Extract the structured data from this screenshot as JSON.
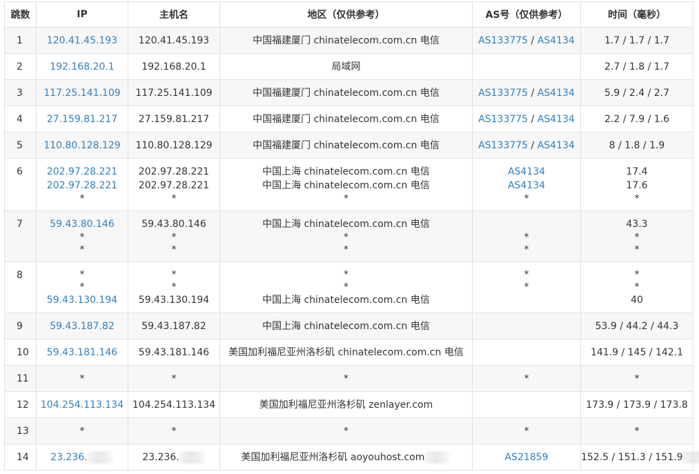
{
  "headers": {
    "hop": "跳数",
    "ip": "IP",
    "host": "主机名",
    "region": "地区（仅供参考）",
    "as": "AS号（仅供参考）",
    "time": "时间（毫秒）"
  },
  "rows": [
    {
      "hop": "1",
      "ip": [
        "120.41.45.193"
      ],
      "host": [
        "120.41.45.193"
      ],
      "region": [
        "中国福建厦门 chinatelecom.com.cn 电信"
      ],
      "as": [
        [
          "AS133775",
          "AS4134"
        ]
      ],
      "time": [
        "1.7 / 1.7 / 1.7"
      ]
    },
    {
      "hop": "2",
      "ip": [
        "192.168.20.1"
      ],
      "host": [
        "192.168.20.1"
      ],
      "region": [
        "局域网"
      ],
      "as": [
        []
      ],
      "time": [
        "2.7 / 1.8 / 1.7"
      ]
    },
    {
      "hop": "3",
      "ip": [
        "117.25.141.109"
      ],
      "host": [
        "117.25.141.109"
      ],
      "region": [
        "中国福建厦门 chinatelecom.com.cn 电信"
      ],
      "as": [
        [
          "AS133775",
          "AS4134"
        ]
      ],
      "time": [
        "5.9 / 2.4 / 2.7"
      ]
    },
    {
      "hop": "4",
      "ip": [
        "27.159.81.217"
      ],
      "host": [
        "27.159.81.217"
      ],
      "region": [
        "中国福建厦门 chinatelecom.com.cn 电信"
      ],
      "as": [
        [
          "AS133775",
          "AS4134"
        ]
      ],
      "time": [
        "2.2 / 7.9 / 1.6"
      ]
    },
    {
      "hop": "5",
      "ip": [
        "110.80.128.129"
      ],
      "host": [
        "110.80.128.129"
      ],
      "region": [
        "中国福建厦门 chinatelecom.com.cn 电信"
      ],
      "as": [
        [
          "AS133775",
          "AS4134"
        ]
      ],
      "time": [
        "8 / 1.8 / 1.9"
      ]
    },
    {
      "hop": "6",
      "ip": [
        "202.97.28.221",
        "202.97.28.221",
        "*"
      ],
      "host": [
        "202.97.28.221",
        "202.97.28.221",
        "*"
      ],
      "region": [
        "中国上海 chinatelecom.com.cn 电信",
        "中国上海 chinatelecom.com.cn 电信",
        "*"
      ],
      "as": [
        [
          "AS4134"
        ],
        [
          "AS4134"
        ],
        [
          "*"
        ]
      ],
      "time": [
        "17.4",
        "17.6",
        "*"
      ]
    },
    {
      "hop": "7",
      "ip": [
        "59.43.80.146",
        "*",
        "*"
      ],
      "host": [
        "59.43.80.146",
        "*",
        "*"
      ],
      "region": [
        "中国上海 chinatelecom.com.cn 电信",
        "*",
        "*"
      ],
      "as": [
        [],
        [
          "*"
        ],
        [
          "*"
        ]
      ],
      "time": [
        "43.3",
        "*",
        "*"
      ]
    },
    {
      "hop": "8",
      "ip": [
        "*",
        "*",
        "59.43.130.194"
      ],
      "host": [
        "*",
        "*",
        "59.43.130.194"
      ],
      "region": [
        "*",
        "*",
        "中国上海 chinatelecom.com.cn 电信"
      ],
      "as": [
        [
          "*"
        ],
        [
          "*"
        ],
        []
      ],
      "time": [
        "*",
        "*",
        "40"
      ]
    },
    {
      "hop": "9",
      "ip": [
        "59.43.187.82"
      ],
      "host": [
        "59.43.187.82"
      ],
      "region": [
        "中国上海 chinatelecom.com.cn 电信"
      ],
      "as": [
        []
      ],
      "time": [
        "53.9 / 44.2 / 44.3"
      ]
    },
    {
      "hop": "10",
      "ip": [
        "59.43.181.146"
      ],
      "host": [
        "59.43.181.146"
      ],
      "region": [
        "美国加利福尼亚州洛杉矶 chinatelecom.com.cn 电信"
      ],
      "as": [
        []
      ],
      "time": [
        "141.9 / 145 / 142.1"
      ]
    },
    {
      "hop": "11",
      "ip": [
        "*"
      ],
      "host": [
        "*"
      ],
      "region": [
        "*"
      ],
      "as": [
        [
          "*"
        ]
      ],
      "time": [
        "*"
      ]
    },
    {
      "hop": "12",
      "ip": [
        "104.254.113.134"
      ],
      "host": [
        "104.254.113.134"
      ],
      "region": [
        "美国加利福尼亚州洛杉矶 zenlayer.com"
      ],
      "as": [
        []
      ],
      "time": [
        "173.9 / 173.9 / 173.8"
      ]
    },
    {
      "hop": "13",
      "ip": [
        "*"
      ],
      "host": [
        "*"
      ],
      "region": [
        "*"
      ],
      "as": [
        [
          "*"
        ]
      ],
      "time": [
        "*"
      ]
    },
    {
      "hop": "14",
      "ip": [
        "23.236."
      ],
      "host": [
        "23.236."
      ],
      "region": [
        "美国加利福尼亚州洛杉矶 aoyouhost.com"
      ],
      "as": [
        [
          "AS21859"
        ]
      ],
      "time": [
        "152.5 / 151.3 / 151.9"
      ],
      "redacted": true
    }
  ],
  "as_separator": " / ",
  "colors": {
    "link": "#2f7fbf",
    "text": "#333333",
    "row_alt": "#f7f7f7",
    "border": "#e2e2e2"
  }
}
